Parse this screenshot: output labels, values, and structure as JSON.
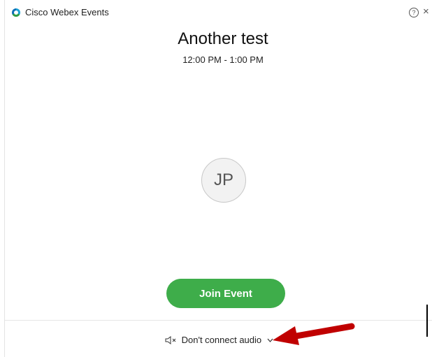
{
  "window": {
    "title": "Cisco Webex Events",
    "logo_icon": "webex-logo-icon",
    "help_glyph": "?",
    "close_glyph": "×"
  },
  "event": {
    "title": "Another test",
    "time": "12:00 PM - 1:00 PM"
  },
  "avatar": {
    "initials": "JP"
  },
  "actions": {
    "join_label": "Join Event",
    "join_color": "#3ead4a"
  },
  "audio": {
    "label": "Don't connect audio",
    "icon": "speaker-muted-icon"
  },
  "annotation": {
    "arrow_color": "#c00000",
    "icon": "red-arrow-icon"
  }
}
